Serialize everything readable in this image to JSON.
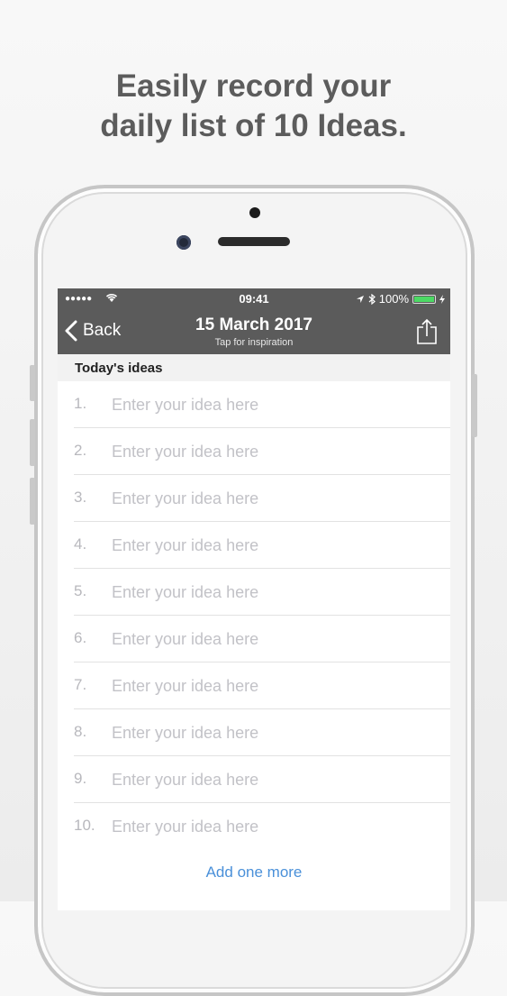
{
  "headline": {
    "line1": "Easily record your",
    "line2": "daily list of 10 Ideas."
  },
  "status_bar": {
    "signal": "●●●●●",
    "time": "09:41",
    "battery_text": "100%",
    "battery_level": 1.0
  },
  "navbar": {
    "back_label": "Back",
    "title": "15 March 2017",
    "subtitle": "Tap for inspiration",
    "background": "#5b5b5b"
  },
  "section": {
    "title": "Today's ideas"
  },
  "ideas": [
    {
      "number": "1.",
      "placeholder": "Enter your idea here",
      "value": ""
    },
    {
      "number": "2.",
      "placeholder": "Enter your idea here",
      "value": ""
    },
    {
      "number": "3.",
      "placeholder": "Enter your idea here",
      "value": ""
    },
    {
      "number": "4.",
      "placeholder": "Enter your idea here",
      "value": ""
    },
    {
      "number": "5.",
      "placeholder": "Enter your idea here",
      "value": ""
    },
    {
      "number": "6.",
      "placeholder": "Enter your idea here",
      "value": ""
    },
    {
      "number": "7.",
      "placeholder": "Enter your idea here",
      "value": ""
    },
    {
      "number": "8.",
      "placeholder": "Enter your idea here",
      "value": ""
    },
    {
      "number": "9.",
      "placeholder": "Enter your idea here",
      "value": ""
    },
    {
      "number": "10.",
      "placeholder": "Enter your idea here",
      "value": ""
    }
  ],
  "add_more_label": "Add one more",
  "colors": {
    "accent": "#4a90d9",
    "battery": "#4cd964"
  },
  "icons": [
    "wifi-icon",
    "location-arrow-icon",
    "bluetooth-icon",
    "battery-icon",
    "chevron-left-icon",
    "share-icon"
  ]
}
